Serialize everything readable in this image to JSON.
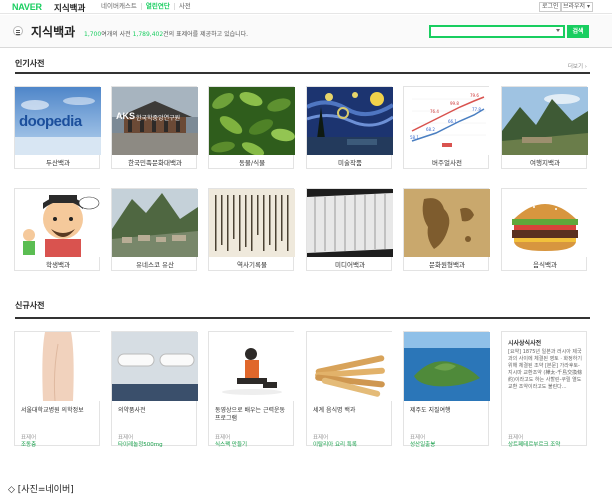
{
  "topbar": {
    "logo": "NAVER",
    "service": "지식백과",
    "nav": [
      "네이버캐스트",
      "열린연단",
      "사전"
    ],
    "login": "로그인",
    "browser": "브라우저 ▾"
  },
  "header": {
    "title": "지식백과",
    "desc_pre": " ",
    "desc_count1": "1,700",
    "desc_mid": "여개의 사전 ",
    "desc_count2": "1,789,402",
    "desc_post": "건의 표제어를 제공하고 있습니다.",
    "search_value": "",
    "search_button": "검색"
  },
  "popular": {
    "title": "인기사전",
    "more": "더보기 ›",
    "items": [
      "두산백과",
      "한국민족문화대백과",
      "동물/식물",
      "미술작품",
      "버주얼사전",
      "여행지백과",
      "학생백과",
      "유네스코 유산",
      "역사기록물",
      "미디어백과",
      "문화원형백과",
      "음식백과"
    ],
    "thumb_texts": {
      "doopedia": "doopedia",
      "aks": "AKS",
      "aks_sub": "한국학중앙연구원"
    },
    "chart_ticks": [
      "79.6",
      "99.8",
      "76.4",
      "77.8",
      "66.1",
      "68.2",
      "58.1"
    ]
  },
  "recent": {
    "title": "신규사전",
    "items": [
      {
        "title": "서울대학교병원 의학정보",
        "type": "표제어",
        "foot": "조동층"
      },
      {
        "title": "의약품사전",
        "type": "표제어",
        "foot": "타이레놀정500mg"
      },
      {
        "title": "동영상으로 배우는 근력운동 프로그램",
        "type": "표제어",
        "foot": "식스팩 만들기"
      },
      {
        "title": "세계 음식명 백과",
        "type": "표제어",
        "foot": "이탈리아 요리 특록"
      },
      {
        "title": "제주도 지질여행",
        "type": "표제어",
        "foot": "성산일출봉"
      },
      {
        "title": "시사상식사전",
        "type": "표제어",
        "foot": "상트페테르부르크 조약"
      }
    ],
    "text_card_body": "[요약] 1875년 일본과 러시아 제국과의 사이에 체결된 영토 · 화정하기 위해 체결된 조약 [본문] 가라후토-지시마 교환조약 (樺太-千島交換條約)이라고도 하는 사할린-쿠릴 열도 교환 조약이라고도 불린다..."
  },
  "caption": "◇ [사진=네이버]"
}
